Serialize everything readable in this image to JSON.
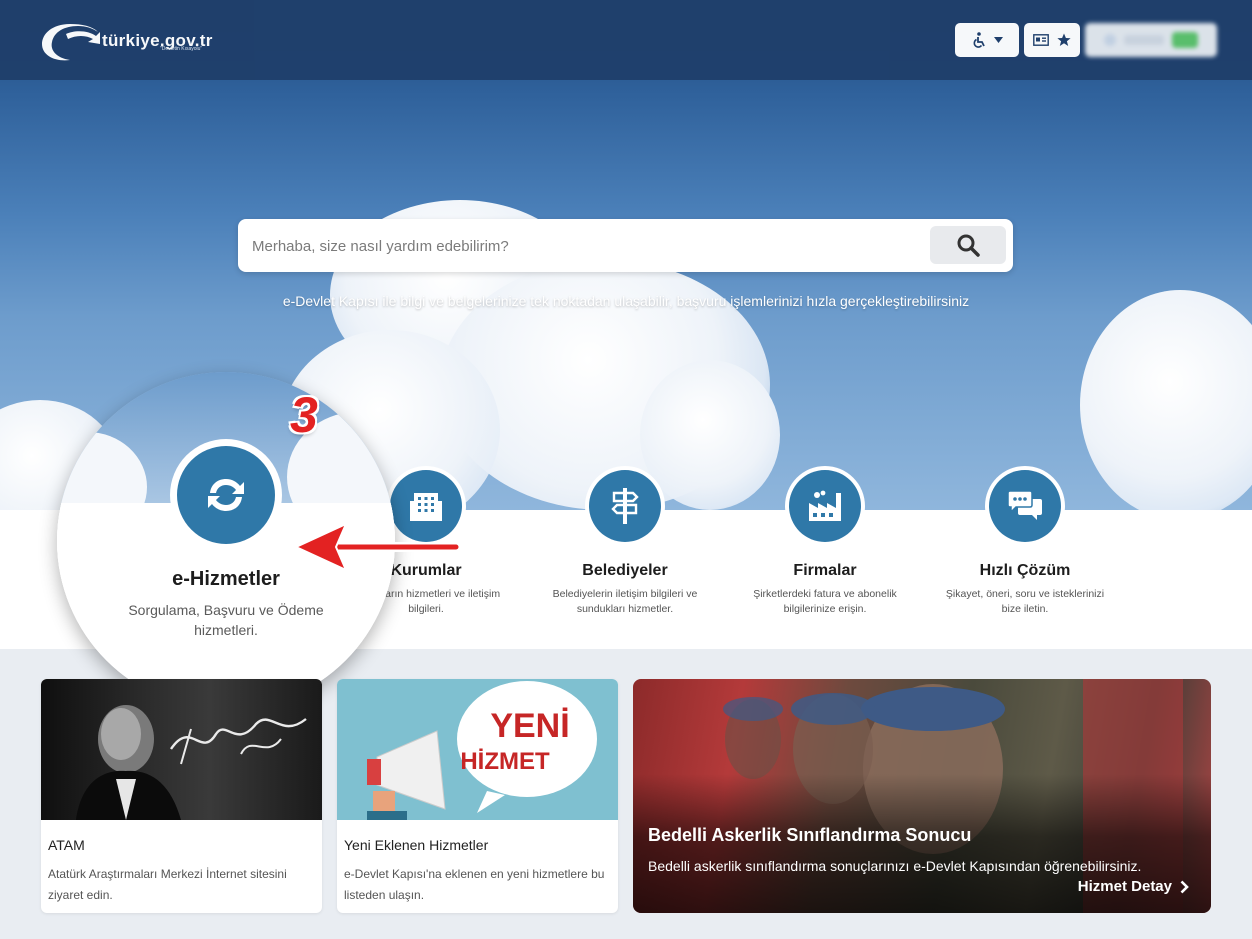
{
  "header": {
    "logo_text": "türkiye.gov.tr",
    "logo_sub": "\"Devletin Kısayolu\"",
    "accessibility_button": "accessibility",
    "favorites_button": "favorites",
    "login_label": "Giriş Yap"
  },
  "search": {
    "placeholder": "Merhaba, size nasıl yardım edebilirim?",
    "tagline": "e-Devlet Kapısı ile bilgi ve belgelerinize tek noktadan ulaşabilir, başvuru işlemlerinizi hızla gerçekleştirebilirsiniz"
  },
  "categories": [
    {
      "title": "e-Hizmetler",
      "desc": "Sorgulama, Başvuru ve Ödeme hizmetleri.",
      "icon": "refresh-icon"
    },
    {
      "title": "Kurumlar",
      "desc": "Kurumların hizmetleri ve iletişim bilgileri.",
      "icon": "building-icon"
    },
    {
      "title": "Belediyeler",
      "desc": "Belediyelerin iletişim bilgileri ve sundukları hizmetler.",
      "icon": "signpost-icon"
    },
    {
      "title": "Firmalar",
      "desc": "Şirketlerdeki fatura ve abonelik bilgilerinize erişin.",
      "icon": "factory-icon"
    },
    {
      "title": "Hızlı Çözüm",
      "desc": "Şikayet, öneri, soru ve isteklerinizi bize iletin.",
      "icon": "chat-icon"
    }
  ],
  "annotation": {
    "step": "3"
  },
  "cards": [
    {
      "title": "ATAM",
      "desc": "Atatürk Araştırmaları Merkezi İnternet sitesini ziyaret edin.",
      "image_text": "K. Atatürk"
    },
    {
      "title": "Yeni Eklenen Hizmetler",
      "desc": "e-Devlet Kapısı'na eklenen en yeni hizmetlere bu listeden ulaşın.",
      "image_line1": "YENİ",
      "image_line2": "HİZMET"
    }
  ],
  "featured": {
    "title": "Bedelli Askerlik Sınıflandırma Sonucu",
    "desc": "Bedelli askerlik sınıflandırma sonuçlarınızı e-Devlet Kapısından öğrenebilirsiniz.",
    "link": "Hizmet Detay"
  },
  "colors": {
    "primary": "#2f78a8",
    "header": "#1f3f6b",
    "accent": "#e32222"
  }
}
